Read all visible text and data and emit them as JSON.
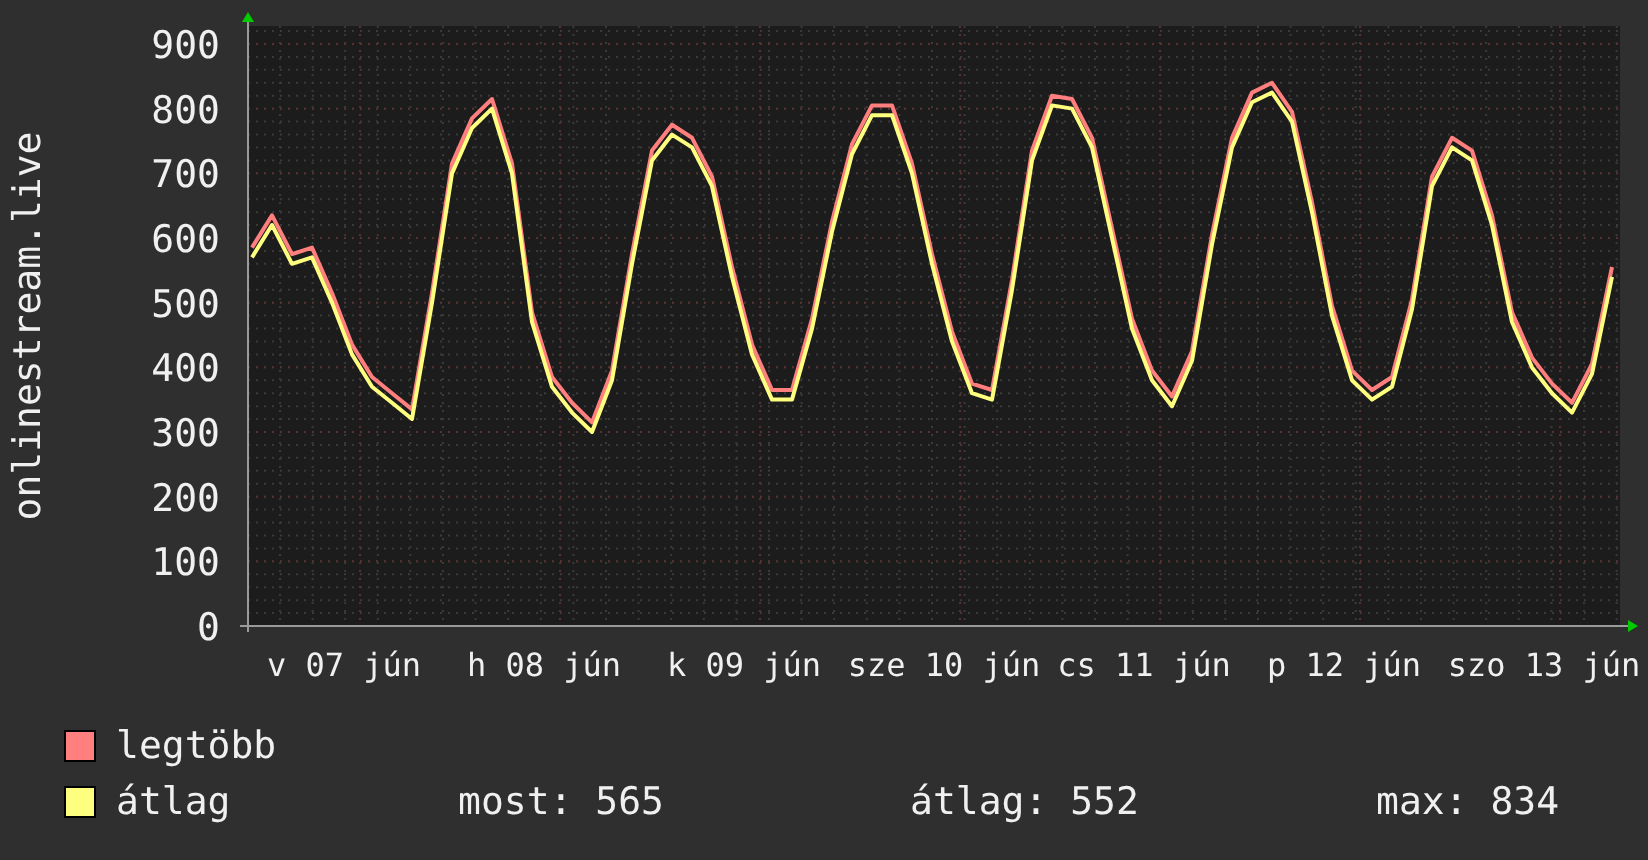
{
  "chart": {
    "x_labels": [
      "v 07 jún",
      "h 08 jún",
      "k 09 jún",
      "sze 10 jún",
      "cs 11 jún",
      "p 12 jún",
      "szo 13 jún"
    ],
    "chart_data": {
      "type": "line",
      "ylabel": "onlinestream.live",
      "ylim": [
        0,
        900
      ],
      "yticks": [
        0,
        100,
        200,
        300,
        400,
        500,
        600,
        700,
        800,
        900
      ],
      "grid": true,
      "series": [
        {
          "name": "legtöbb",
          "color": "#ff7f7f",
          "values": [
            585,
            635,
            575,
            585,
            515,
            435,
            385,
            360,
            335,
            515,
            715,
            785,
            815,
            715,
            485,
            385,
            345,
            315,
            395,
            575,
            735,
            775,
            755,
            695,
            555,
            435,
            365,
            365,
            475,
            625,
            745,
            805,
            805,
            715,
            575,
            455,
            375,
            365,
            535,
            735,
            820,
            815,
            755,
            615,
            475,
            395,
            355,
            425,
            605,
            755,
            825,
            840,
            795,
            655,
            495,
            395,
            365,
            385,
            505,
            695,
            755,
            735,
            635,
            485,
            415,
            375,
            345,
            405,
            555
          ]
        },
        {
          "name": "átlag",
          "color": "#ffff7f",
          "values": [
            570,
            620,
            560,
            570,
            500,
            420,
            370,
            345,
            320,
            500,
            700,
            770,
            800,
            700,
            470,
            370,
            330,
            300,
            380,
            560,
            720,
            760,
            740,
            680,
            540,
            420,
            350,
            350,
            460,
            610,
            730,
            790,
            790,
            700,
            560,
            440,
            360,
            350,
            520,
            720,
            805,
            800,
            740,
            600,
            460,
            380,
            340,
            410,
            590,
            740,
            810,
            825,
            780,
            640,
            480,
            380,
            350,
            370,
            490,
            680,
            740,
            720,
            620,
            470,
            400,
            360,
            330,
            390,
            540
          ]
        }
      ]
    }
  },
  "stats": [
    "most: 565",
    "átlag: 552",
    "max: 834"
  ]
}
